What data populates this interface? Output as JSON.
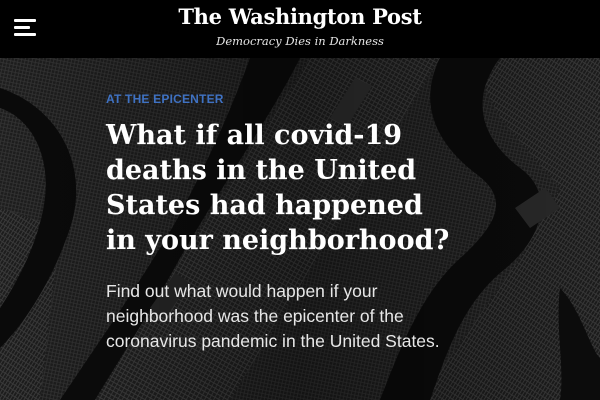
{
  "header": {
    "logo": "The Washington Post",
    "tagline": "Democracy Dies in Darkness",
    "menu_icon": "hamburger-menu-icon"
  },
  "article": {
    "kicker": "AT THE EPICENTER",
    "headline": "What if all covid-19 deaths in the United States had happened in your neighborhood?",
    "dek": "Find out what would happen if your neighborhood was the epicenter of the coronavirus pandemic in the United States."
  },
  "colors": {
    "background": "#000000",
    "kicker": "#3f72c3",
    "text": "#ffffff"
  }
}
